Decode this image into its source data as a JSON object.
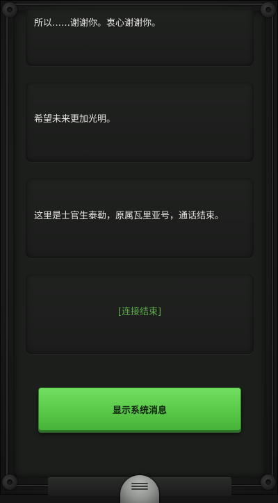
{
  "messages": [
    {
      "text": "所以……谢谢你。衷心谢谢你。"
    },
    {
      "text": "希望未来更加光明。"
    },
    {
      "text": "这里是士官生泰勒，原属瓦里亚号，通话结束。"
    },
    {
      "text": "[连接结束]"
    }
  ],
  "action_button": {
    "label": "显示系统消息"
  },
  "menu": {
    "icon": "hamburger-menu-icon"
  },
  "colors": {
    "background": "#1c1e1c",
    "text": "#e6e6e2",
    "system_text": "#5fae4a",
    "button": "#59c848"
  }
}
